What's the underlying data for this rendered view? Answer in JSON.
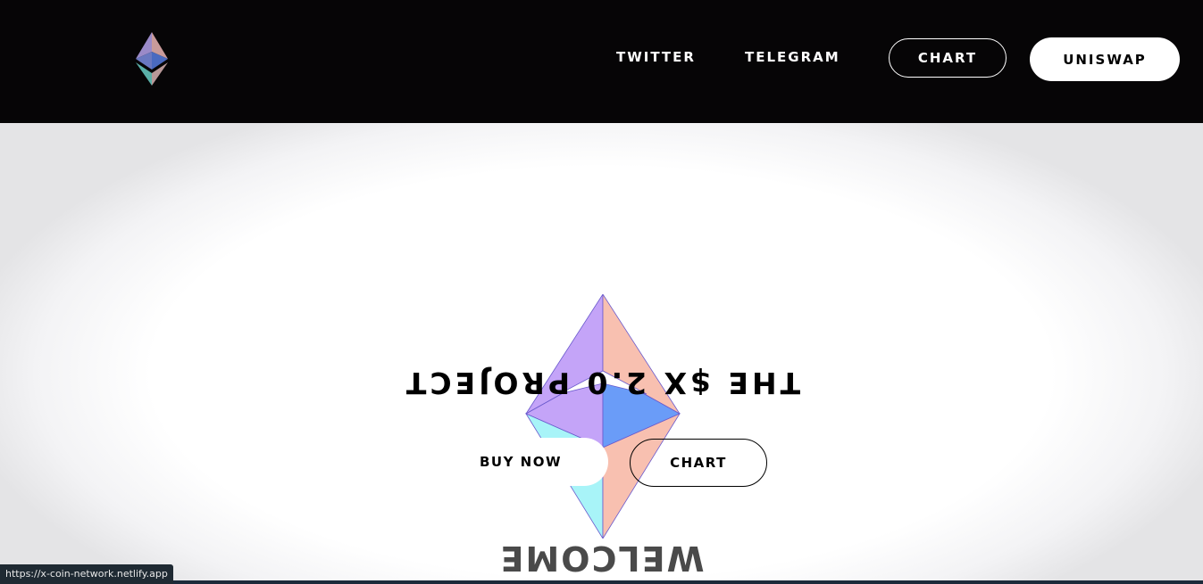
{
  "header": {
    "logo_icon": "ethereum-diamond-icon",
    "nav": {
      "twitter": "TWITTER",
      "telegram": "TELEGRAM",
      "chart": "CHART",
      "uniswap": "UNISWAP"
    }
  },
  "hero": {
    "emblem_icon": "ethereum-diamond-icon",
    "title": "THE $X 2.0 PROJECT",
    "buy_button": "BUY NOW",
    "chart_button": "CHART",
    "welcome": "WELCOME"
  },
  "status_bar": {
    "url": "https://x-coin-network.netlify.app"
  },
  "colors": {
    "header_bg": "#060506",
    "purple": "#c4a4f8",
    "peach": "#f8c0b0",
    "blue": "#6a9cf8",
    "cyan": "#a8f4f8"
  }
}
